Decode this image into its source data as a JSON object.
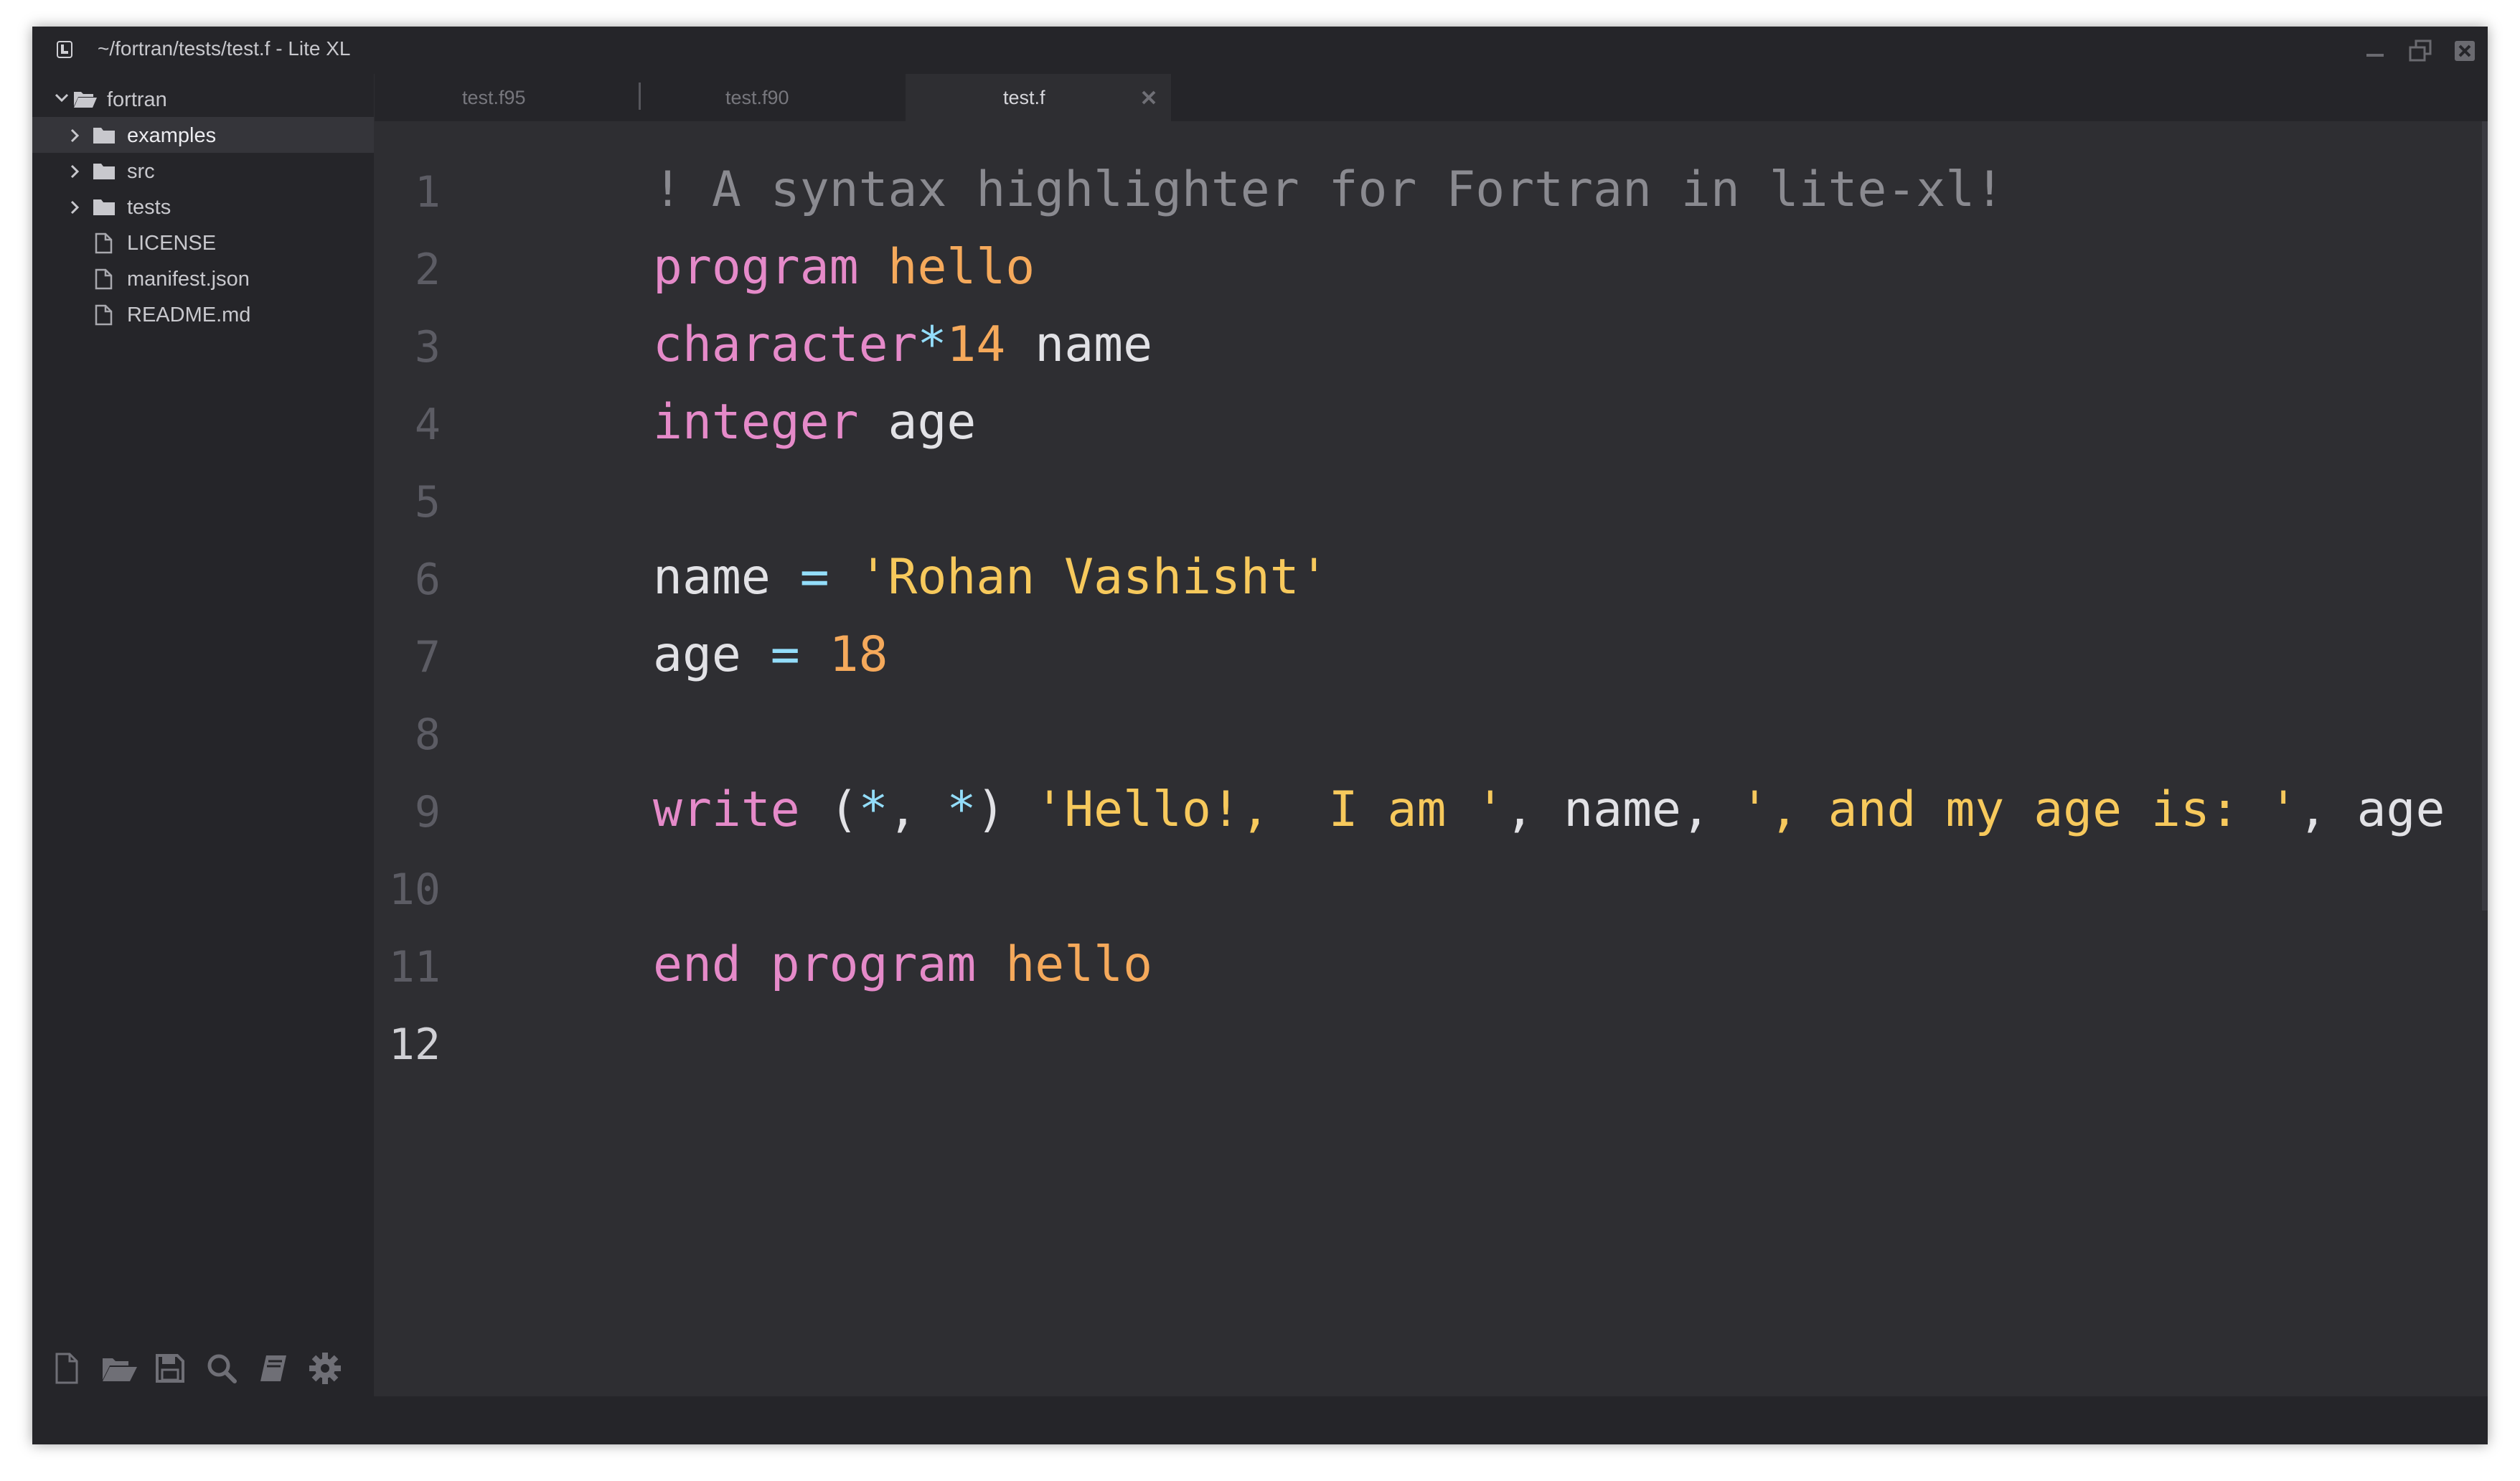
{
  "window": {
    "title": "~/fortran/tests/test.f - Lite XL"
  },
  "sidebar": {
    "root": {
      "label": "fortran",
      "icon": "folder-open-icon",
      "expanded": true
    },
    "items": [
      {
        "label": "examples",
        "type": "folder",
        "icon": "folder-icon",
        "selected": true
      },
      {
        "label": "src",
        "type": "folder",
        "icon": "folder-icon"
      },
      {
        "label": "tests",
        "type": "folder",
        "icon": "folder-icon"
      },
      {
        "label": "LICENSE",
        "type": "file",
        "icon": "file-icon"
      },
      {
        "label": "manifest.json",
        "type": "file",
        "icon": "file-icon"
      },
      {
        "label": "README.md",
        "type": "file",
        "icon": "file-icon"
      }
    ],
    "toolbar": [
      "new-file-icon",
      "open-folder-icon",
      "save-icon",
      "search-icon",
      "book-icon",
      "gear-icon"
    ]
  },
  "tabs": [
    {
      "label": "test.f95",
      "active": false
    },
    {
      "label": "test.f90",
      "active": false
    },
    {
      "label": "test.f",
      "active": true
    }
  ],
  "editor": {
    "line_numbers": [
      "1",
      "2",
      "3",
      "4",
      "5",
      "6",
      "7",
      "8",
      "9",
      "10",
      "11",
      "12"
    ],
    "current_line": "12",
    "lines": [
      [
        [
          "comment",
          "! A syntax highlighter for Fortran in lite-xl!"
        ]
      ],
      [
        [
          "keyword",
          "program"
        ],
        [
          "normal",
          " "
        ],
        [
          "function",
          "hello"
        ]
      ],
      [
        [
          "keyword",
          "character"
        ],
        [
          "operator",
          "*"
        ],
        [
          "number",
          "14"
        ],
        [
          "normal",
          " name"
        ]
      ],
      [
        [
          "keyword",
          "integer"
        ],
        [
          "normal",
          " age"
        ]
      ],
      [],
      [
        [
          "normal",
          "name "
        ],
        [
          "operator",
          "="
        ],
        [
          "normal",
          " "
        ],
        [
          "string",
          "'Rohan Vashisht'"
        ]
      ],
      [
        [
          "normal",
          "age "
        ],
        [
          "operator",
          "="
        ],
        [
          "normal",
          " "
        ],
        [
          "number",
          "18"
        ]
      ],
      [],
      [
        [
          "keyword",
          "write"
        ],
        [
          "normal",
          " ("
        ],
        [
          "operator",
          "*"
        ],
        [
          "normal",
          ", "
        ],
        [
          "operator",
          "*"
        ],
        [
          "normal",
          ") "
        ],
        [
          "string",
          "'Hello!,  I am '"
        ],
        [
          "normal",
          ", name, "
        ],
        [
          "string",
          "', and my age is: '"
        ],
        [
          "normal",
          ", age"
        ]
      ],
      [],
      [
        [
          "keyword",
          "end"
        ],
        [
          "normal",
          " "
        ],
        [
          "keyword",
          "program"
        ],
        [
          "normal",
          " "
        ],
        [
          "function",
          "hello"
        ]
      ],
      []
    ]
  },
  "colors": {
    "background": "#2e2e32",
    "sidebar": "#252529",
    "keyword": "#e58ac9",
    "function": "#f5a95b",
    "string": "#f7c95c",
    "operator": "#93ddfa",
    "comment": "#8a8a90"
  }
}
